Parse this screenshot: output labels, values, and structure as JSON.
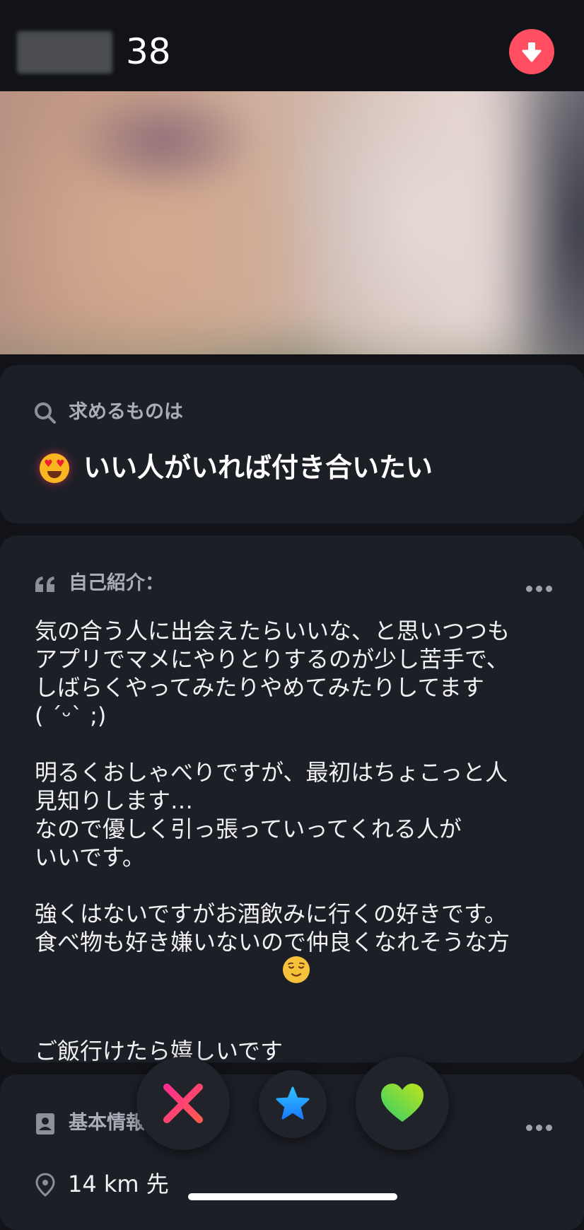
{
  "header": {
    "age": "38"
  },
  "seeking": {
    "label": "求めるものは",
    "value": "いい人がいれば付き合いたい"
  },
  "intro": {
    "label": "自己紹介：",
    "bio": "気の合う人に出会えたらいいな、と思いつつも\nアプリでマメにやりとりするのが少し苦手で、\nしばらくやってみたりやめてみたりしてます\n( ˊᵕˋ ;)\n\n明るくおしゃべりですが、最初はちょこっと人\n見知りします…\nなので優しく引っ張っていってくれる人が\nいいです。\n\n強くはないですがお酒飲みに行くの好きです。\n食べ物も好き嫌いないので仲良くなれそうな方\nご飯行けたら嬉しいです"
  },
  "basic": {
    "label": "基本情報",
    "distance": "14 km 先"
  },
  "colors": {
    "background": "#111319",
    "card": "#1d1f27",
    "nope_gradient": [
      "#ff2d8f",
      "#ff5a4f"
    ],
    "super_like": "#1fa3ff",
    "like_gradient": [
      "#3fd66b",
      "#b9e31f"
    ],
    "down_button": "#ff4f60"
  },
  "icons": {
    "down": "arrow-down-icon",
    "search": "search-icon",
    "quote": "quote-icon",
    "more": "more-dots-icon",
    "id_card": "id-card-icon",
    "location": "location-pin-icon",
    "nope": "x-icon",
    "super_like": "star-icon",
    "like": "heart-icon"
  }
}
